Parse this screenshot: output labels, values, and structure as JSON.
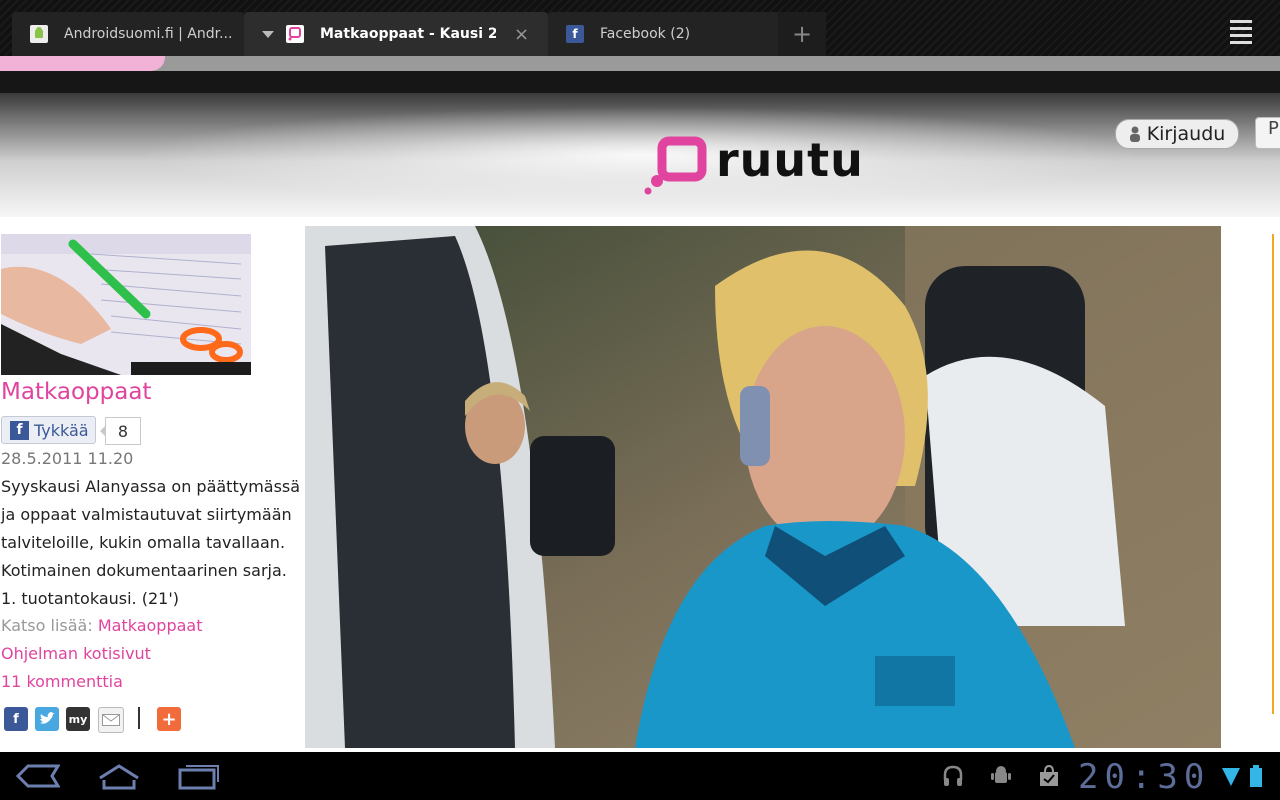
{
  "browser": {
    "tabs": [
      {
        "label": "Androidsuomi.fi | Andr...",
        "favicon": "android-favicon-icon"
      },
      {
        "label": "Matkaoppaat - Kausi 2 ...",
        "favicon": "ruutu-favicon-icon",
        "active": true
      },
      {
        "label": "Facebook (2)",
        "favicon": "facebook-favicon-icon"
      }
    ],
    "new_tab_symbol": "+",
    "close_symbol": "×"
  },
  "site": {
    "logo_text": "ruutu",
    "login_label": "Kirjaudu",
    "partial_button": "P",
    "brand_color": "#e0449e"
  },
  "program": {
    "title": "Matkaoppaat",
    "like_label": "Tykkää",
    "like_count": "8",
    "date": "28.5.2011 11.20",
    "description": "Syyskausi Alanyassa on päättymässä ja oppaat valmistautuvat siirtymään talviteloille, kukin omalla tavallaan. Kotimainen dokumentaarinen sarja. 1. tuotantokausi. (21')",
    "see_more_prefix": "Katso lisää:",
    "see_more_link": "Matkaoppaat",
    "homepage_link": "Ohjelman kotisivut",
    "comments_link": "11 kommenttia",
    "share_icons": [
      "facebook-share-icon",
      "twitter-share-icon",
      "myspace-share-icon",
      "email-share-icon",
      "more-share-icon"
    ],
    "myspace_text": "my"
  },
  "system": {
    "clock": "20:30",
    "status_icons": [
      "headphones-icon",
      "android-debug-icon",
      "shopping-bag-icon",
      "wifi-icon",
      "battery-icon"
    ]
  }
}
